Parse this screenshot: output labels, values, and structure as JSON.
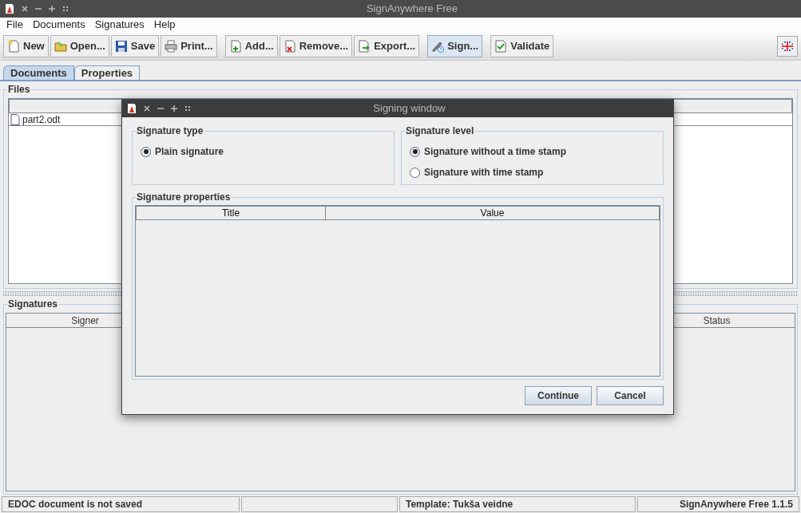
{
  "window": {
    "title": "SignAnywhere Free"
  },
  "menu": [
    "File",
    "Documents",
    "Signatures",
    "Help"
  ],
  "toolbar": [
    [
      {
        "label": "New",
        "kind": "new",
        "selected": false
      },
      {
        "label": "Open...",
        "kind": "open",
        "selected": false
      },
      {
        "label": "Save",
        "kind": "save",
        "selected": false
      },
      {
        "label": "Print...",
        "kind": "print",
        "selected": false
      }
    ],
    [
      {
        "label": "Add...",
        "kind": "add",
        "selected": false
      },
      {
        "label": "Remove...",
        "kind": "remove",
        "selected": false
      },
      {
        "label": "Export...",
        "kind": "export",
        "selected": false
      }
    ],
    [
      {
        "label": "Sign...",
        "kind": "sign",
        "selected": true
      }
    ],
    [
      {
        "label": "Validate",
        "kind": "validate",
        "selected": false
      }
    ]
  ],
  "tabs": [
    {
      "label": "Documents",
      "selected": true
    },
    {
      "label": "Properties",
      "selected": false
    }
  ],
  "files": {
    "title": "Files",
    "rows": [
      {
        "name": "part2.odt"
      }
    ]
  },
  "signatures": {
    "title": "Signatures",
    "columns": [
      "Signer",
      "Status"
    ]
  },
  "status_bar": {
    "message": "EDOC document is not saved",
    "template": "Template: Tukša veidne",
    "version": "SignAnywhere Free 1.1.5"
  },
  "dialog": {
    "title": "Signing window",
    "signature_type": {
      "title": "Signature type",
      "options": [
        {
          "label": "Plain signature",
          "selected": true
        }
      ]
    },
    "signature_level": {
      "title": "Signature level",
      "options": [
        {
          "label": "Signature without a time stamp",
          "selected": true
        },
        {
          "label": "Signature with time stamp",
          "selected": false
        }
      ]
    },
    "properties": {
      "title": "Signature properties",
      "columns": [
        "Title",
        "Value"
      ]
    },
    "buttons": [
      {
        "label": "Continue",
        "kind": "primary"
      },
      {
        "label": "Cancel",
        "kind": "secondary"
      }
    ]
  }
}
